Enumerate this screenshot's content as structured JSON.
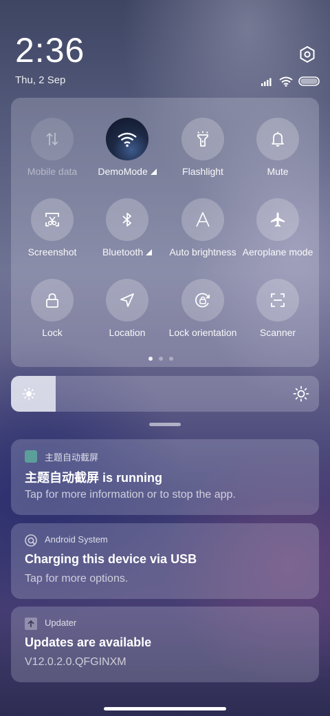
{
  "status": {
    "time": "2:36",
    "date": "Thu, 2 Sep",
    "icons": [
      "signal-icon",
      "wifi-icon",
      "battery-icon"
    ]
  },
  "header": {
    "settings_icon": "settings-hexagon-icon"
  },
  "quick_settings": {
    "tiles": [
      {
        "label": "Mobile data",
        "icon": "mobile-data-icon",
        "active": false
      },
      {
        "label": "DemoMode",
        "icon": "wifi-icon",
        "active": true
      },
      {
        "label": "Flashlight",
        "icon": "flashlight-icon",
        "active": false
      },
      {
        "label": "Mute",
        "icon": "bell-icon",
        "active": false
      },
      {
        "label": "Screenshot",
        "icon": "screenshot-icon",
        "active": false
      },
      {
        "label": "Bluetooth",
        "icon": "bluetooth-icon",
        "active": false
      },
      {
        "label": "Auto brightness",
        "icon": "auto-brightness-icon",
        "active": false
      },
      {
        "label": "Aeroplane mode",
        "icon": "airplane-icon",
        "active": false
      },
      {
        "label": "Lock",
        "icon": "lock-icon",
        "active": false
      },
      {
        "label": "Location",
        "icon": "location-icon",
        "active": false
      },
      {
        "label": "Lock orientation",
        "icon": "lock-orientation-icon",
        "active": false
      },
      {
        "label": "Scanner",
        "icon": "scanner-icon",
        "active": false
      }
    ],
    "pages": 3,
    "current_page": 1
  },
  "brightness": {
    "level": 0.145
  },
  "notifications": [
    {
      "app": "主题自动截屏",
      "title": "主题自动截屏 is running",
      "body": "Tap for more information or to stop the app.",
      "icon": "app-square-icon"
    },
    {
      "app": "Android System",
      "title": "Charging this device via USB",
      "body": "Tap for more options.",
      "icon": "android-system-icon"
    },
    {
      "app": "Updater",
      "title": "Updates are available",
      "body": "V12.0.2.0.QFGINXM",
      "icon": "updater-icon"
    }
  ]
}
